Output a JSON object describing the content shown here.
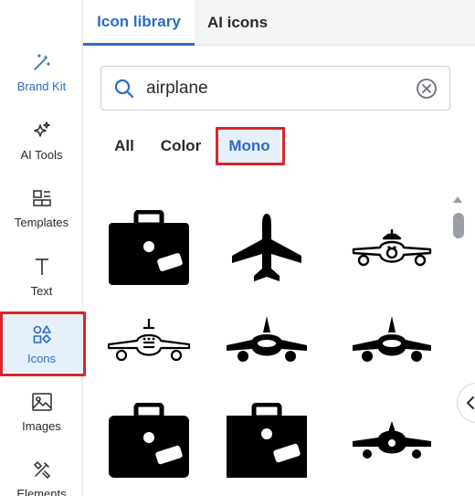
{
  "rail": {
    "items": [
      {
        "label": "Brand Kit",
        "icon": "magic-wand-icon"
      },
      {
        "label": "AI Tools",
        "icon": "sparkles-icon"
      },
      {
        "label": "Templates",
        "icon": "templates-icon"
      },
      {
        "label": "Text",
        "icon": "text-icon"
      },
      {
        "label": "Icons",
        "icon": "shapes-icon"
      },
      {
        "label": "Images",
        "icon": "image-icon"
      },
      {
        "label": "Elements",
        "icon": "elements-icon"
      }
    ],
    "active": "Icons"
  },
  "tabs": [
    {
      "label": "Icon library",
      "active": true
    },
    {
      "label": "AI icons",
      "active": false
    }
  ],
  "search": {
    "value": "airplane",
    "icons": [
      "search-icon",
      "clear-icon"
    ]
  },
  "filters": [
    {
      "label": "All",
      "selected": false
    },
    {
      "label": "Color",
      "selected": false
    },
    {
      "label": "Mono",
      "selected": true
    }
  ],
  "results": [
    "briefcase-tag-icon",
    "airplane-top-view-icon",
    "airplane-front-outline-icon",
    "airplane-front-outline-icon",
    "airplane-front-solid-icon",
    "airplane-front-solid-icon",
    "briefcase-tag-icon",
    "briefcase-tag-icon",
    "airplane-front-solid-icon"
  ],
  "colors": {
    "accent": "#2b6cc4",
    "highlight": "#d9262b",
    "activeBg": "#e6f0fb"
  }
}
